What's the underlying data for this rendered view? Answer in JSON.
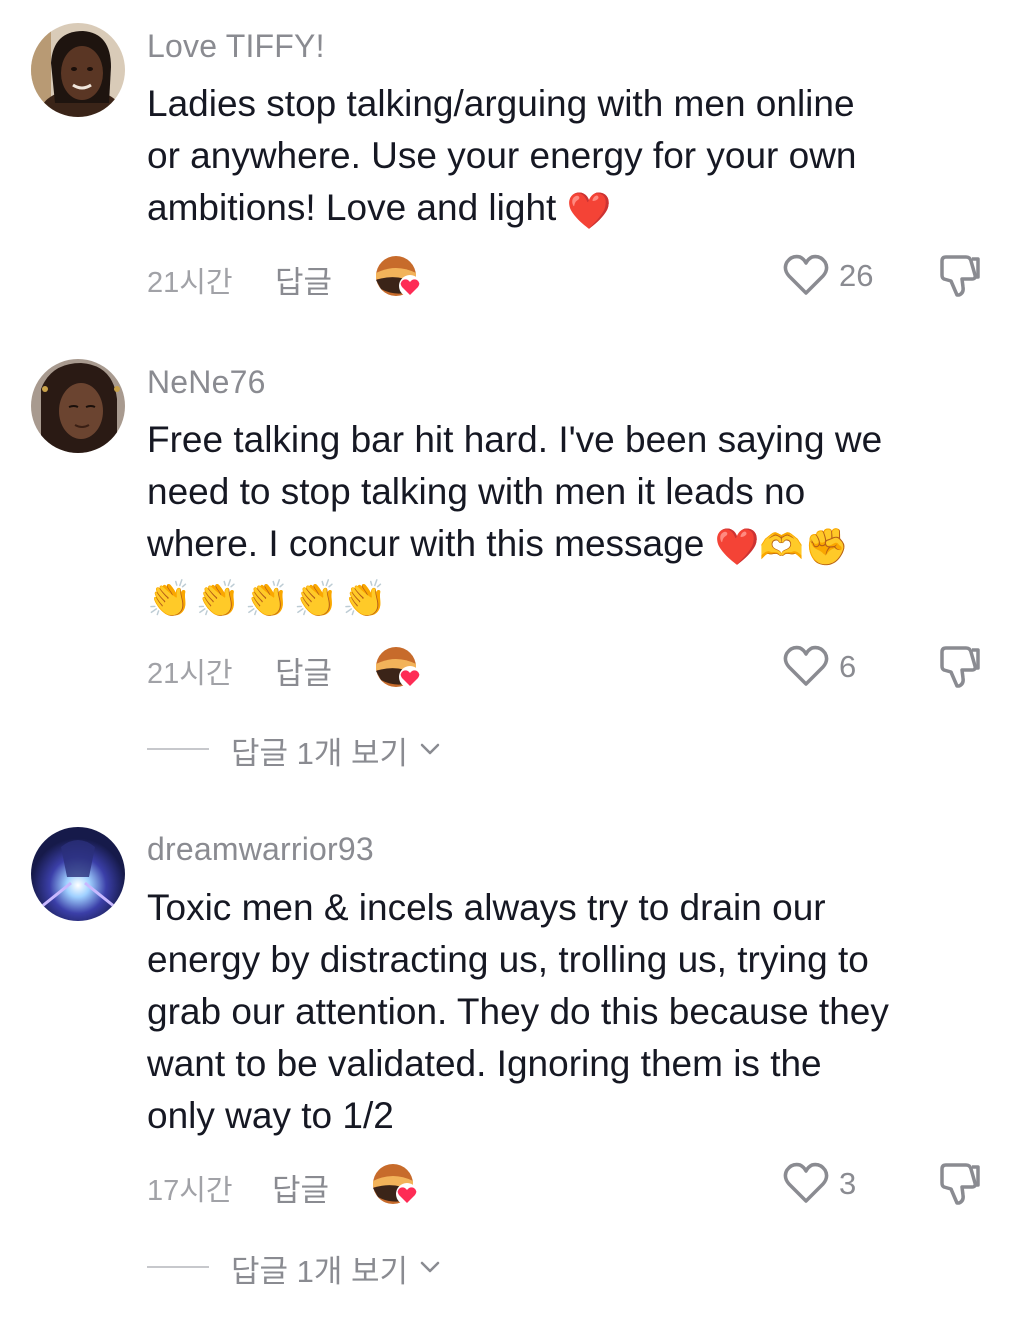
{
  "comments": [
    {
      "username": "Love TIFFY!",
      "text_lines": [
        "Ladies stop talking/arguing with men online",
        "or anywhere. Use your energy for your own",
        "ambitions! Love and light"
      ],
      "trailing_emoji": "❤️",
      "time": "21시간",
      "reply_label": "답글",
      "likes": "26",
      "avatar_icon": "user-avatar",
      "view_replies": null
    },
    {
      "username": "NeNe76",
      "text_lines": [
        "Free talking bar hit hard. I've been saying we",
        "need to stop talking with men it leads no",
        "where. I concur with this message"
      ],
      "trailing_emoji": "❤️🫶✊",
      "emoji_line": "👏👏👏👏👏",
      "time": "21시간",
      "reply_label": "답글",
      "likes": "6",
      "avatar_icon": "user-avatar",
      "view_replies": "답글 1개 보기"
    },
    {
      "username": "dreamwarrior93",
      "text_lines": [
        "Toxic men & incels always try to drain our",
        "energy by distracting us, trolling us, trying to",
        "grab our attention. They do this because they",
        "want to be validated. Ignoring them is the",
        "only way to 1/2"
      ],
      "time": "17시간",
      "reply_label": "답글",
      "likes": "3",
      "avatar_icon": "user-avatar",
      "view_replies": "답글 1개 보기"
    }
  ],
  "icons": {
    "like": "heart-outline-icon",
    "dislike": "thumbs-down-icon",
    "creator_liked": "creator-liked-badge",
    "expand": "chevron-down-icon"
  },
  "colors": {
    "text": "#161823",
    "secondary": "#8a8b91",
    "liked_heart": "#fe2c55"
  }
}
